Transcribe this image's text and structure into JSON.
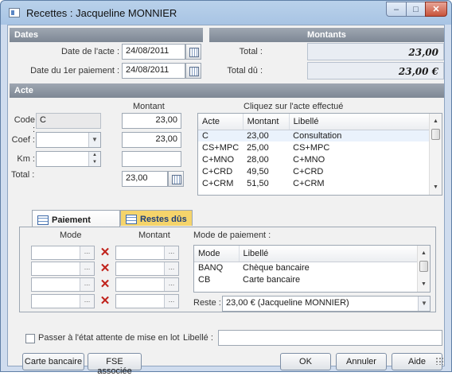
{
  "window": {
    "title": "Recettes : Jacqueline MONNIER",
    "buttons": {
      "minimize": "–",
      "maximize": "□",
      "close": "✕"
    }
  },
  "dates": {
    "header": "Dates",
    "date_acte_label": "Date de l'acte :",
    "date_acte_value": "24/08/2011",
    "date_paiement_label": "Date du 1er paiement :",
    "date_paiement_value": "24/08/2011"
  },
  "montants": {
    "header": "Montants",
    "total_label": "Total :",
    "total_value": "23,00",
    "total_du_label": "Total dû :",
    "total_du_value": "23,00 €"
  },
  "acte": {
    "header": "Acte",
    "montant_header": "Montant",
    "code_label": "Code :",
    "code_value": "C",
    "code_montant": "23,00",
    "coef_label": "Coef :",
    "coef_value": "",
    "coef_montant": "23,00",
    "km_label": "Km :",
    "km_value": "",
    "km_montant": "",
    "total_label": "Total :",
    "total_value": "23,00",
    "instruction": "Cliquez sur l'acte effectué",
    "grid_columns": [
      "Acte",
      "Montant",
      "Libellé"
    ],
    "grid_rows": [
      [
        "C",
        "23,00",
        "Consultation"
      ],
      [
        "CS+MPC",
        "25,00",
        "CS+MPC"
      ],
      [
        "C+MNO",
        "28,00",
        "C+MNO"
      ],
      [
        "C+CRD",
        "49,50",
        "C+CRD"
      ],
      [
        "C+CRM",
        "51,50",
        "C+CRM"
      ]
    ]
  },
  "tabs": [
    {
      "label": "Paiement",
      "active": true
    },
    {
      "label": "Restes dûs",
      "active": false
    }
  ],
  "paiement": {
    "mode_header": "Mode",
    "montant_header": "Montant",
    "dots": "...",
    "mode_paiement_label": "Mode de paiement :",
    "grid_columns": [
      "Mode",
      "Libellé"
    ],
    "grid_rows": [
      [
        "BANQ",
        "Chèque bancaire"
      ],
      [
        "CB",
        "Carte bancaire"
      ]
    ],
    "reste_label": "Reste :",
    "reste_value": "23,00 € (Jacqueline MONNIER)"
  },
  "footer": {
    "checkbox_label": "Passer à l'état attente de mise en lot",
    "libelle_label": "Libellé :",
    "libelle_value": "",
    "carte_bancaire": "Carte bancaire",
    "fse_associee": "FSE associée",
    "ok": "OK",
    "annuler": "Annuler",
    "aide": "Aide"
  },
  "colors": {
    "section_header": "#8b939e",
    "delete_x": "#c0211a",
    "tab_inactive": "#f5d46b"
  }
}
